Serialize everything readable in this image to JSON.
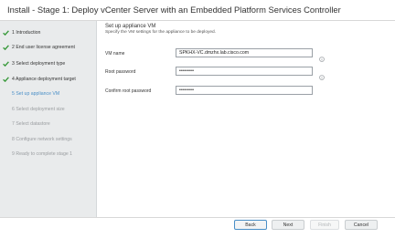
{
  "window": {
    "title": "Install - Stage 1: Deploy vCenter Server with an Embedded Platform Services Controller"
  },
  "sidebar": {
    "steps": [
      {
        "label": "1 Introduction",
        "state": "done"
      },
      {
        "label": "2 End user license agreement",
        "state": "done"
      },
      {
        "label": "3 Select deployment type",
        "state": "done"
      },
      {
        "label": "4 Appliance deployment target",
        "state": "done"
      },
      {
        "label": "5 Set up appliance VM",
        "state": "active"
      },
      {
        "label": "6 Select deployment size",
        "state": "pending"
      },
      {
        "label": "7 Select datastore",
        "state": "pending"
      },
      {
        "label": "8 Configure network settings",
        "state": "pending"
      },
      {
        "label": "9 Ready to complete stage 1",
        "state": "pending"
      }
    ]
  },
  "main": {
    "section_title": "Set up appliance VM",
    "section_subtitle": "Specify the VM settings for the appliance to be deployed.",
    "fields": {
      "vm_name": {
        "label": "VM name",
        "value": "SPKHX-VC.dmzhx.lab.cisco.com"
      },
      "root_password": {
        "label": "Root password",
        "value": "••••••••"
      },
      "confirm_password": {
        "label": "Confirm root password",
        "value": "••••••••"
      }
    }
  },
  "footer": {
    "back": "Back",
    "next": "Next",
    "finish": "Finish",
    "cancel": "Cancel"
  },
  "colors": {
    "accent": "#4a8fc7",
    "check": "#3a9a3c",
    "sidebar_bg": "#e9ebec"
  },
  "icons": {
    "done": "checkmark-icon",
    "info": "info-icon"
  }
}
